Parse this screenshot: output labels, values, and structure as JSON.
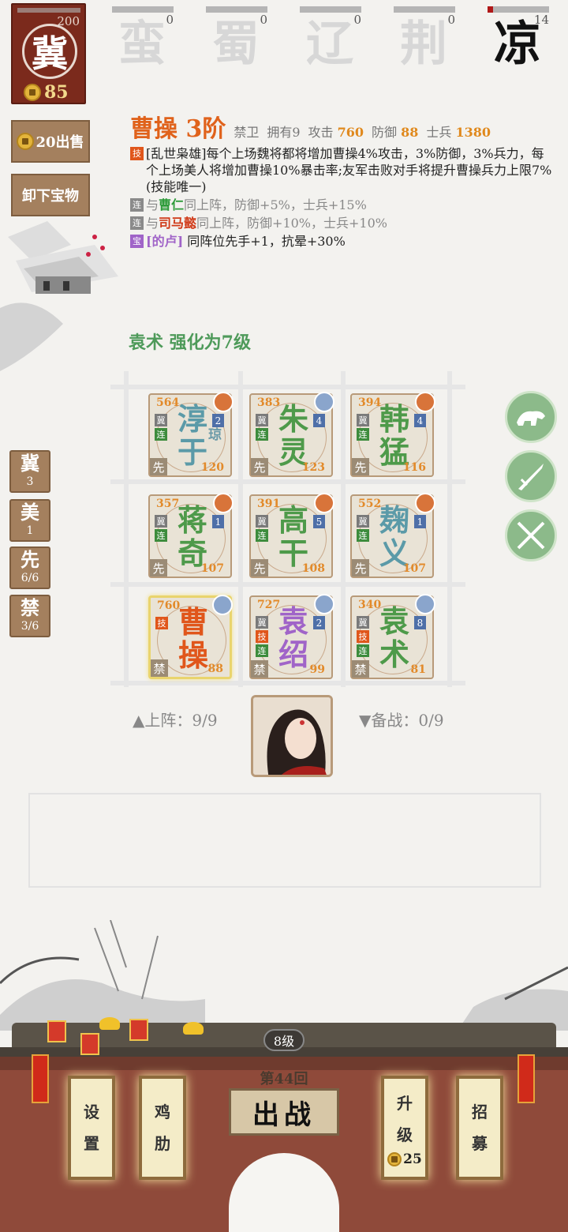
{
  "faction_card": {
    "glyph": "冀",
    "count": "200",
    "gold": "85"
  },
  "factions": [
    {
      "glyph": "蛮",
      "count": "0",
      "progress": 0
    },
    {
      "glyph": "蜀",
      "count": "0",
      "progress": 0
    },
    {
      "glyph": "辽",
      "count": "0",
      "progress": 0
    },
    {
      "glyph": "荆",
      "count": "0",
      "progress": 0
    },
    {
      "glyph": "凉",
      "count": "14",
      "progress": 0.07
    }
  ],
  "left_buttons": {
    "sell": "20出售",
    "unequip": "卸下宝物"
  },
  "hero": {
    "name": "曹操 3阶",
    "role": "禁卫",
    "owned": "拥有9",
    "atk_lbl": "攻击",
    "atk": "760",
    "def_lbl": "防御",
    "def": "88",
    "troop_lbl": "士兵",
    "troop": "1380",
    "skill_tag": "技",
    "skill": "[乱世枭雄]每个上场魏将都将增加曹操4%攻击，3%防御，3%兵力，每个上场美人将增加曹操10%暴击率;友军击败对手将提升曹操兵力上限7%(技能唯一)",
    "link_tag": "连",
    "link1_pre": "与",
    "link1_name": "曹仁",
    "link1_post": "同上阵，防御+5%，士兵+15%",
    "link2_pre": "与",
    "link2_name": "司马懿",
    "link2_post": "同上阵，防御+10%，士兵+10%",
    "treasure_tag": "宝",
    "treasure_name": "[的卢]",
    "treasure_post": " 同阵位先手+1，抗晕+30%"
  },
  "upgrade_note": "袁术 强化为7级",
  "grid": [
    {
      "atk": "564",
      "def": "120",
      "name1": "淳",
      "name2": "于",
      "sub": "琼",
      "lvl": "2",
      "tags": [
        "冀",
        "连"
      ],
      "pos": "先",
      "color": "#5b9aa8"
    },
    {
      "atk": "383",
      "def": "123",
      "name1": "朱",
      "name2": "灵",
      "sub": "",
      "lvl": "4",
      "tags": [
        "冀",
        "连"
      ],
      "pos": "先",
      "color": "#4e9a4a"
    },
    {
      "atk": "394",
      "def": "116",
      "name1": "韩",
      "name2": "猛",
      "sub": "",
      "lvl": "4",
      "tags": [
        "冀",
        "连"
      ],
      "pos": "先",
      "color": "#4e9a4a"
    },
    {
      "atk": "357",
      "def": "107",
      "name1": "蒋",
      "name2": "奇",
      "sub": "",
      "lvl": "1",
      "tags": [
        "冀",
        "连"
      ],
      "pos": "先",
      "color": "#4e9a4a"
    },
    {
      "atk": "391",
      "def": "108",
      "name1": "高",
      "name2": "干",
      "sub": "",
      "lvl": "5",
      "tags": [
        "冀",
        "连"
      ],
      "pos": "先",
      "color": "#4e9a4a"
    },
    {
      "atk": "552",
      "def": "107",
      "name1": "麹",
      "name2": "义",
      "sub": "",
      "lvl": "1",
      "tags": [
        "冀",
        "连"
      ],
      "pos": "先",
      "color": "#5b9aa8"
    },
    {
      "atk": "760",
      "def": "88",
      "name1": "曹",
      "name2": "操",
      "sub": "",
      "lvl": "",
      "tags": [
        "技"
      ],
      "pos": "禁",
      "color": "#e0561b"
    },
    {
      "atk": "727",
      "def": "99",
      "name1": "袁",
      "name2": "绍",
      "sub": "",
      "lvl": "2",
      "tags": [
        "冀",
        "技",
        "连"
      ],
      "pos": "禁",
      "color": "#a064c8"
    },
    {
      "atk": "340",
      "def": "81",
      "name1": "袁",
      "name2": "术",
      "sub": "",
      "lvl": "8",
      "tags": [
        "冀",
        "技",
        "连"
      ],
      "pos": "禁",
      "color": "#4e9a4a"
    }
  ],
  "counters": [
    {
      "label": "冀",
      "value": "3"
    },
    {
      "label": "美",
      "value": "1"
    },
    {
      "label": "先",
      "value": "6/6"
    },
    {
      "label": "禁",
      "value": "3/6"
    }
  ],
  "deploy": "▲上阵：9/9",
  "reserve": "▼备战：0/9",
  "bottom": {
    "level": "8级",
    "round": "第44回",
    "fight": "出战",
    "settings1": "设",
    "settings2": "置",
    "chicken1": "鸡",
    "chicken2": "肋",
    "upgrade1": "升",
    "upgrade2": "级",
    "upgrade_cost": "25",
    "recruit1": "招",
    "recruit2": "募",
    "fu": "福"
  },
  "colors": {
    "accent": "#e0621b",
    "wall": "#8f4a3a",
    "button": "#a4805e",
    "green": "#8cba8a"
  }
}
